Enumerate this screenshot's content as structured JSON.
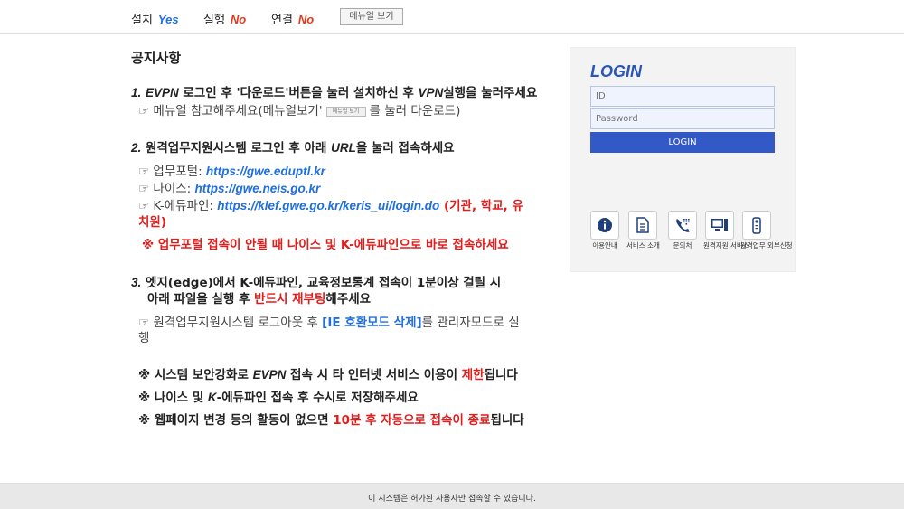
{
  "status": {
    "install": {
      "label": "설치",
      "value": "Yes"
    },
    "run": {
      "label": "실행",
      "value": "No"
    },
    "connect": {
      "label": "연결",
      "value": "No"
    },
    "manual_button": "메뉴얼 보기"
  },
  "notice": {
    "title": "공지사항",
    "item1": {
      "num": "1.",
      "evpn": "EVPN",
      "text_a": " 로그인 후 '다운로드'버튼을 눌러 설치하신 후 ",
      "vpn": "VPN",
      "text_b": "실행을 눌러주세요",
      "sub_a": "☞ 메뉴얼 참고해주세요(메뉴얼보기'",
      "mini_btn": "메뉴얼 보기",
      "sub_b": "를 눌러 다운로드)"
    },
    "item2": {
      "num": "2.",
      "text_a": " 원격업무지원시스템 로그인 후 아래 ",
      "url": "URL",
      "text_b": "을 눌러 접속하세요",
      "portal_label": "☞ 업무포털: ",
      "portal_url": "https://gwe.eduptl.kr",
      "neis_label": "☞ 나이스: ",
      "neis_url": "https://gwe.neis.go.kr",
      "kedu_label": "☞ K-에듀파인: ",
      "kedu_url": "https://klef.gwe.go.kr/keris_ui/login.do",
      "kedu_note_a": " (기관, 학교, 유",
      "kedu_note_b": "치원)",
      "warning": "※ 업무포털 접속이 안될 때 나이스 및 K-에듀파인으로 바로 접속하세요"
    },
    "item3": {
      "num": "3.",
      "text_a": " 엣지(edge)에서 K-에듀파인, 교육정보통계 접속이 1분이상 걸릴 시",
      "text_b": "아래 파일을 실행 후 ",
      "red": "반드시 재부팅",
      "text_c": "해주세요",
      "sub_a": "☞ 원격업무지원시스템 로그아웃 후 ",
      "sub_link": "[IE 호환모드 삭제]",
      "sub_b": "를 관리자모드로 실",
      "sub_c": "행"
    },
    "note1": {
      "a": "※ 시스템 보안강화로 ",
      "evpn": "EVPN",
      "b": " 접속 시 타 인터넷 서비스 이용이 ",
      "red": "제한",
      "c": "됩니다"
    },
    "note2": {
      "a": "※ 나이스 및 ",
      "k": "K",
      "b": "-에듀파인 접속 후 수시로 저장해주세요"
    },
    "note3": {
      "a": "※ 웹페이지 변경 등의 활동이 없으면 ",
      "red": "10분 후 자동으로 접속이 종료",
      "b": "됩니다"
    }
  },
  "login": {
    "title": "LOGIN",
    "id_placeholder": "ID",
    "password_placeholder": "Password",
    "button": "LOGIN",
    "services": [
      {
        "icon": "info-icon",
        "label": "이용안내"
      },
      {
        "icon": "document-icon",
        "label": "서비스 소개"
      },
      {
        "icon": "phone-icon",
        "label": "문의처"
      },
      {
        "icon": "computer-icon",
        "label": "원격지원 서비스"
      },
      {
        "icon": "remote-control-icon",
        "label": "원격업무 외부신청"
      }
    ]
  },
  "footer": {
    "text": "이 시스템은 허가된 사용자만 접속할 수 있습니다."
  },
  "colors": {
    "accent": "#3359c7",
    "link": "#1f6fe0",
    "warning": "#e21b1b"
  }
}
